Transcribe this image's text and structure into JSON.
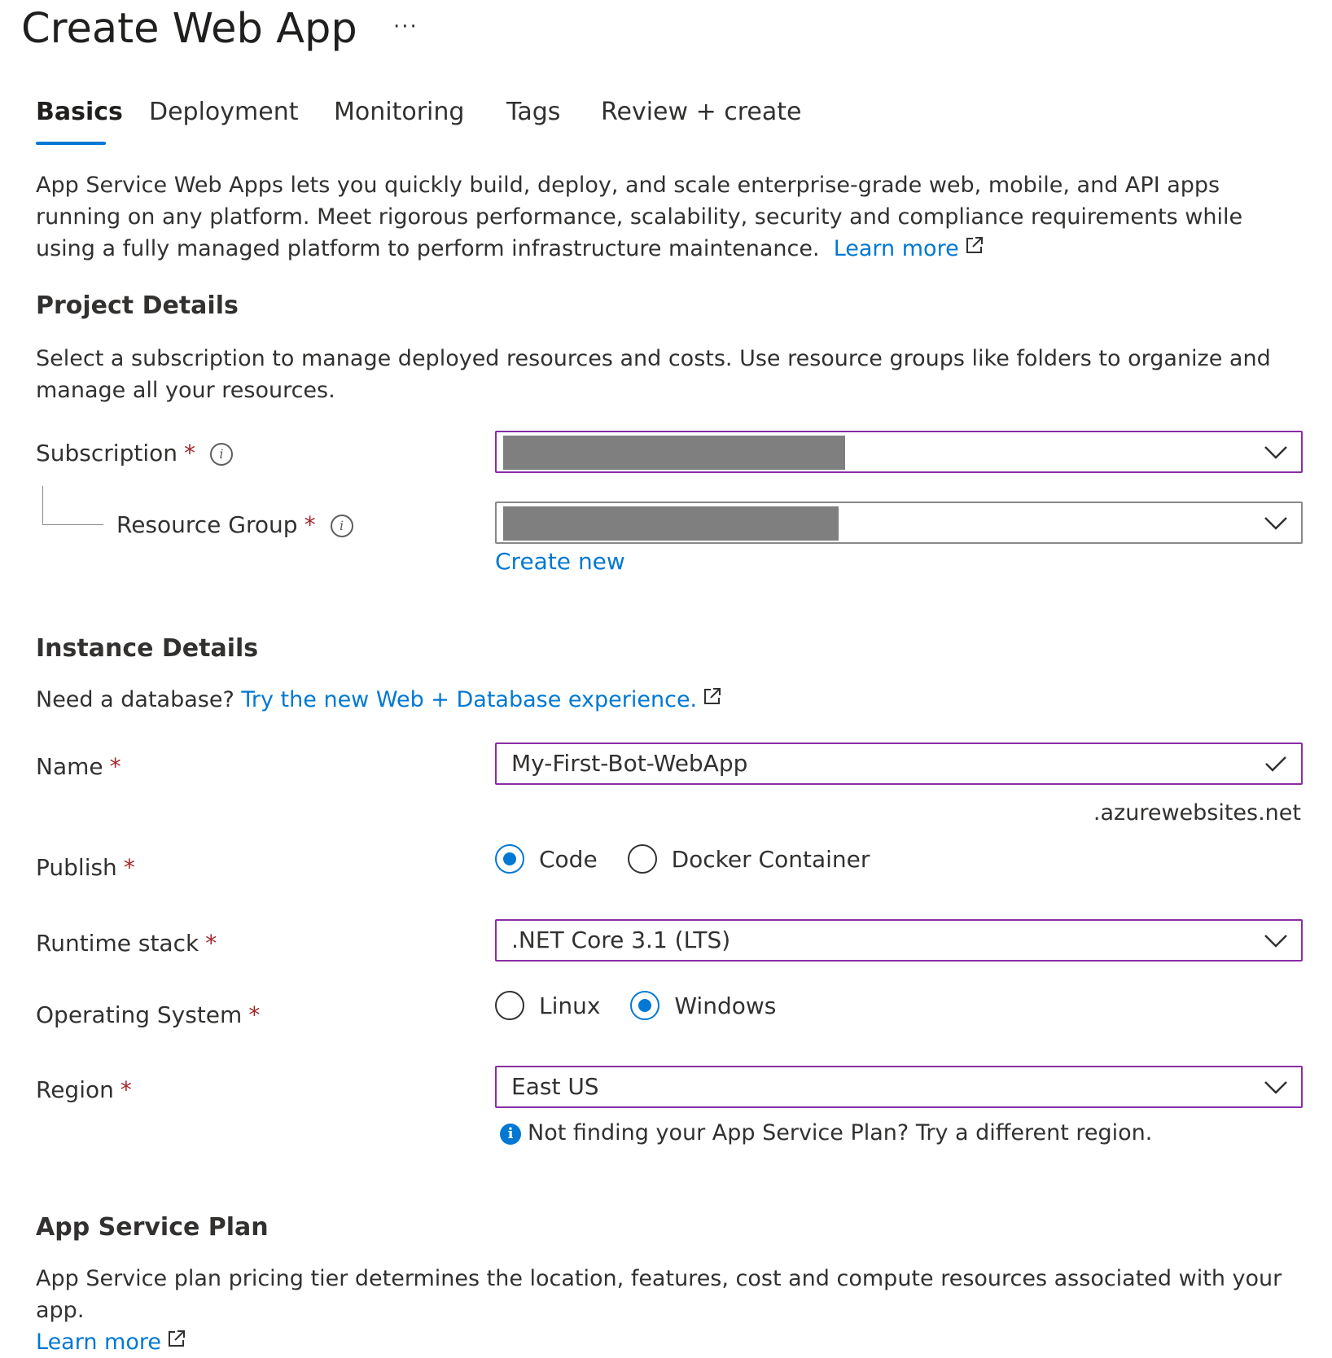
{
  "page": {
    "title": "Create Web App",
    "more": "···"
  },
  "tabs": [
    {
      "label": "Basics",
      "active": true
    },
    {
      "label": "Deployment"
    },
    {
      "label": "Monitoring"
    },
    {
      "label": "Tags"
    },
    {
      "label": "Review + create"
    }
  ],
  "intro": {
    "text": "App Service Web Apps lets you quickly build, deploy, and scale enterprise-grade web, mobile, and API apps running on any platform. Meet rigorous performance, scalability, security and compliance requirements while using a fully managed platform to perform infrastructure maintenance.",
    "link": "Learn more"
  },
  "project": {
    "heading": "Project Details",
    "description": "Select a subscription to manage deployed resources and costs. Use resource groups like folders to organize and manage all your resources.",
    "subscription_label": "Subscription",
    "resource_group_label": "Resource Group",
    "create_new": "Create new"
  },
  "instance": {
    "heading": "Instance Details",
    "db_prompt": "Need a database?",
    "db_link": "Try the new Web + Database experience.",
    "name_label": "Name",
    "name_value": "My-First-Bot-WebApp",
    "name_suffix": ".azurewebsites.net",
    "publish_label": "Publish",
    "publish_options": [
      "Code",
      "Docker Container"
    ],
    "publish_selected": "Code",
    "runtime_label": "Runtime stack",
    "runtime_value": ".NET Core 3.1 (LTS)",
    "os_label": "Operating System",
    "os_options": [
      "Linux",
      "Windows"
    ],
    "os_selected": "Windows",
    "region_label": "Region",
    "region_value": "East US",
    "region_hint": "Not finding your App Service Plan? Try a different region."
  },
  "plan": {
    "heading": "App Service Plan",
    "description": "App Service plan pricing tier determines the location, features, cost and compute resources associated with your app.",
    "link": "Learn more"
  },
  "required_marker": "*",
  "colors": {
    "accent": "#0078d4",
    "focus_border": "#8a2da5",
    "required": "#a4262c",
    "redacted": "#7f7f7f"
  }
}
